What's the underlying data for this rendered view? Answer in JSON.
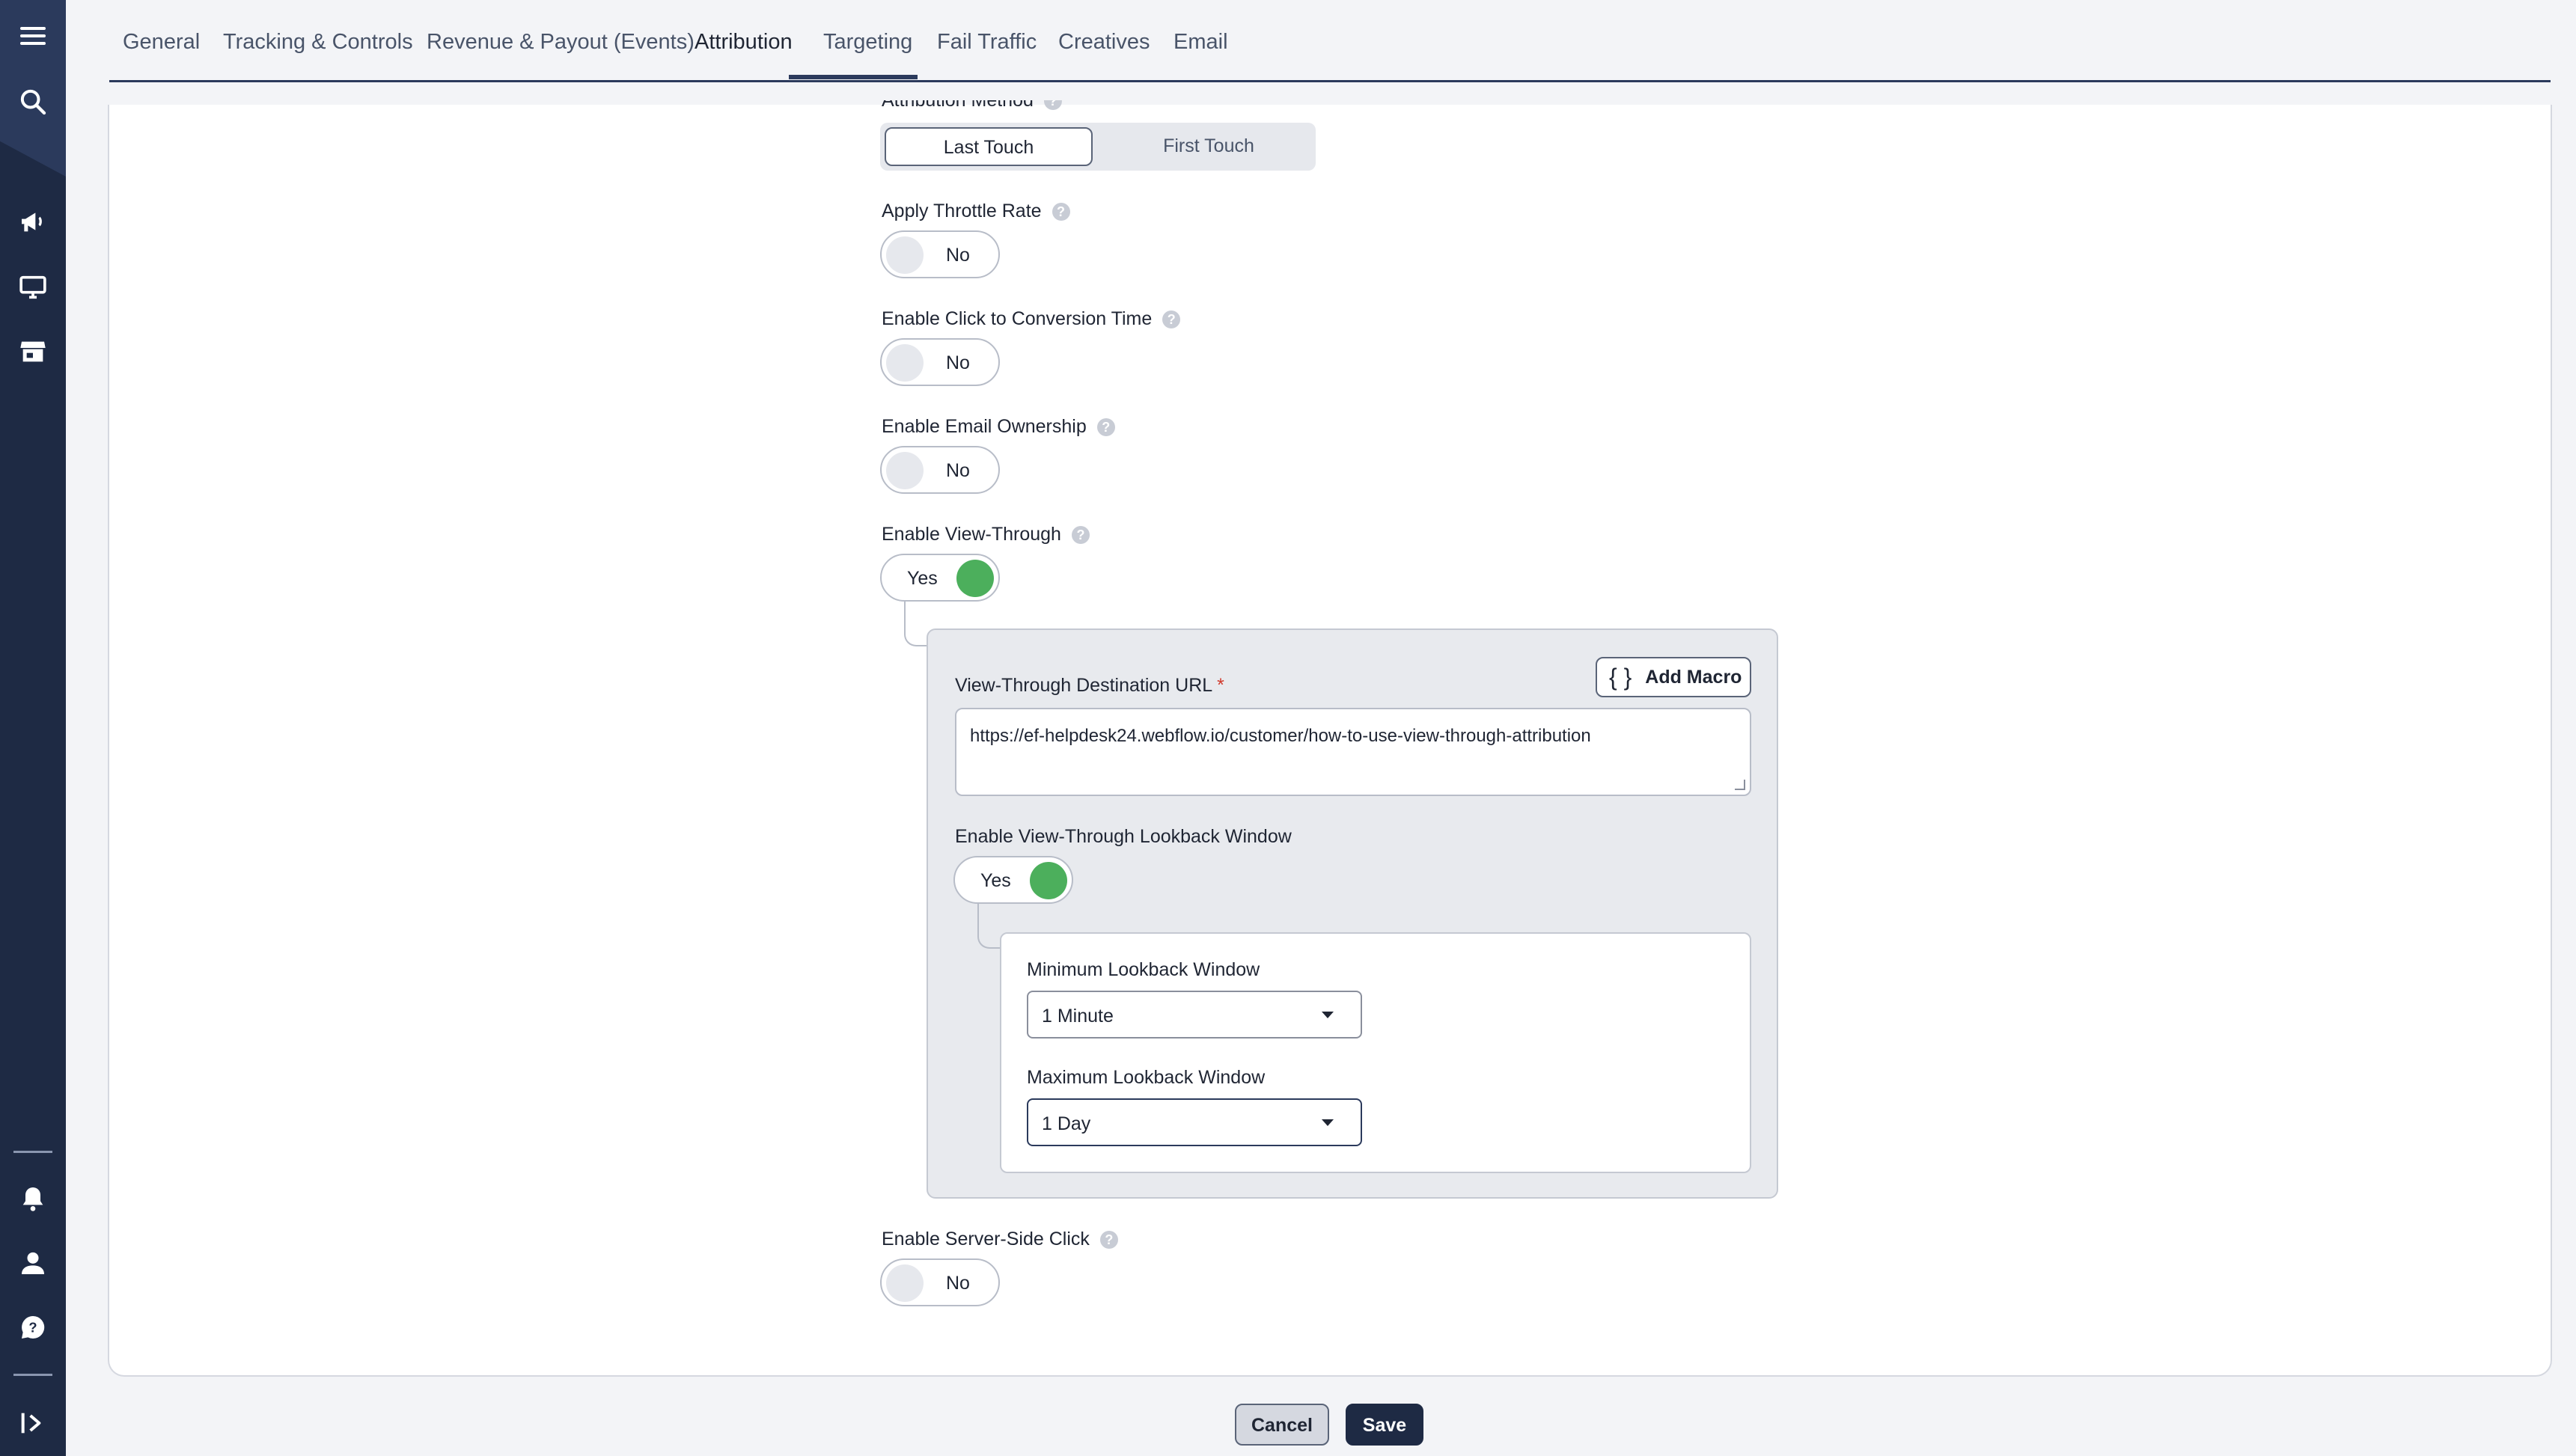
{
  "tabs": [
    {
      "label": "General"
    },
    {
      "label": "Tracking & Controls"
    },
    {
      "label": "Revenue & Payout (Events)"
    },
    {
      "label": "Attribution"
    },
    {
      "label": "Targeting"
    },
    {
      "label": "Fail Traffic"
    },
    {
      "label": "Creatives"
    },
    {
      "label": "Email"
    }
  ],
  "active_tab": "Attribution",
  "attribution": {
    "method_label": "Attribution Method",
    "method_options": [
      "Last Touch",
      "First Touch"
    ],
    "method_selected": "Last Touch",
    "throttle": {
      "label": "Apply Throttle Rate",
      "value": "No"
    },
    "click_to_conversion": {
      "label": "Enable Click to Conversion Time",
      "value": "No"
    },
    "email_ownership": {
      "label": "Enable Email Ownership",
      "value": "No"
    },
    "view_through": {
      "label": "Enable View-Through",
      "value": "Yes"
    },
    "view_through_url": {
      "label": "View-Through Destination URL",
      "required_mark": "*",
      "value": "https://ef-helpdesk24.webflow.io/customer/how-to-use-view-through-attribution"
    },
    "add_macro_label": "Add Macro",
    "add_macro_glyph": "{ }",
    "lookback": {
      "label": "Enable View-Through Lookback Window",
      "value": "Yes"
    },
    "min_lookback": {
      "label": "Minimum Lookback Window",
      "value": "1 Minute"
    },
    "max_lookback": {
      "label": "Maximum Lookback Window",
      "value": "1 Day"
    },
    "server_side_click": {
      "label": "Enable Server-Side Click",
      "value": "No"
    }
  },
  "help_glyph": "?",
  "footer": {
    "cancel_label": "Cancel",
    "save_label": "Save"
  },
  "colors": {
    "rail": "#1e2a44",
    "accent": "#2b3a5c",
    "toggle_on": "#4caf5c"
  }
}
